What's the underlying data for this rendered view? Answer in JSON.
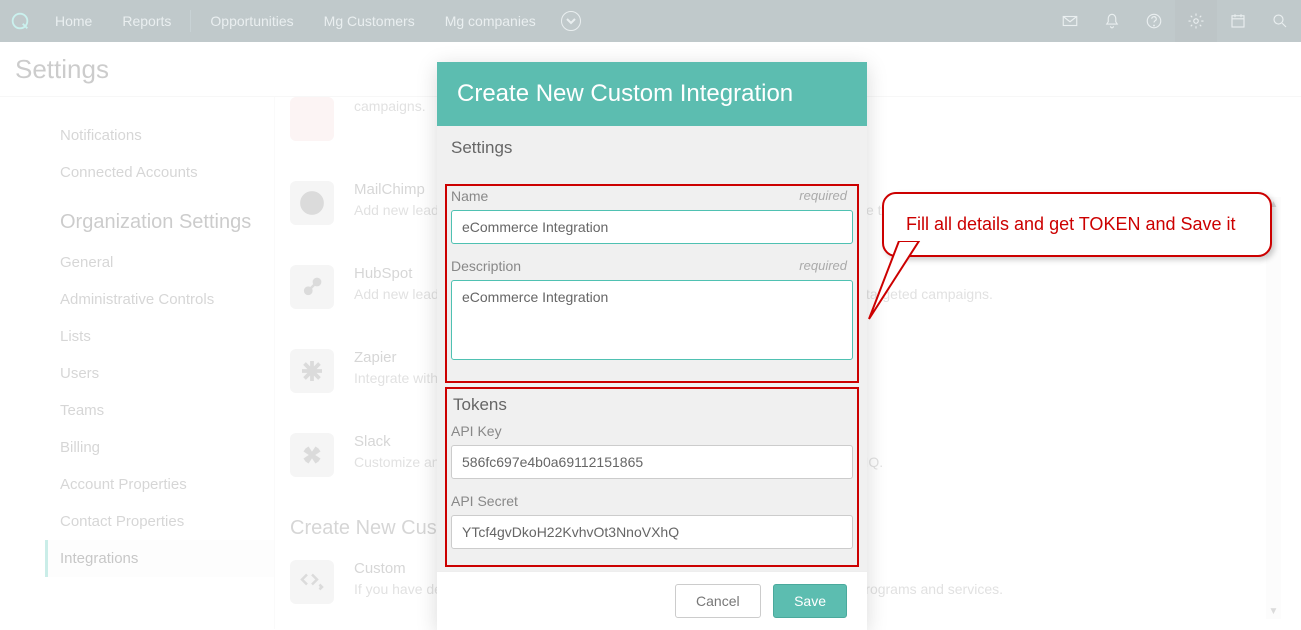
{
  "nav": {
    "items": [
      "Home",
      "Reports",
      "Opportunities",
      "Mg Customers",
      "Mg companies"
    ]
  },
  "page_title": "Settings",
  "sidebar": {
    "top_items": [
      "Notifications",
      "Connected Accounts"
    ],
    "org_heading": "Organization Settings",
    "org_items": [
      "General",
      "Administrative Controls",
      "Lists",
      "Users",
      "Teams",
      "Billing",
      "Account Properties",
      "Contact Properties",
      "Integrations"
    ]
  },
  "integrations": {
    "partial_top": "campaigns.",
    "mailchimp": {
      "title": "MailChimp",
      "desc": "Add new leads and contacts to MailChimp directly from SalesforceIQ to create more targeted marketing campaigns."
    },
    "hubspot": {
      "title": "HubSpot",
      "desc": "Add new leads and contacts to HubSpot directly from SalesforceIQ to create more targeted campaigns."
    },
    "zapier": {
      "title": "Zapier",
      "desc": "Integrate with hundreds of different applications through Zapier."
    },
    "slack": {
      "title": "Slack",
      "desc": "Customize and receive Stream event notifications in Slack, powered by SalesforceIQ."
    },
    "create_heading": "Create New Custom Integrations",
    "custom": {
      "title": "Custom",
      "desc": "If you have developers you can create custom integrations to interface with other programs and services."
    }
  },
  "modal": {
    "title": "Create New Custom Integration",
    "settings_heading": "Settings",
    "name_label": "Name",
    "name_value": "eCommerce Integration",
    "desc_label": "Description",
    "desc_value": "eCommerce Integration",
    "required": "required",
    "tokens_heading": "Tokens",
    "apikey_label": "API Key",
    "apikey_value": "586fc697e4b0a69112151865",
    "apisecret_label": "API Secret",
    "apisecret_value": "YTcf4gvDkoH22KvhvOt3NnoVXhQ",
    "cancel": "Cancel",
    "save": "Save"
  },
  "callout": {
    "text": "Fill all details and get TOKEN and Save it"
  }
}
